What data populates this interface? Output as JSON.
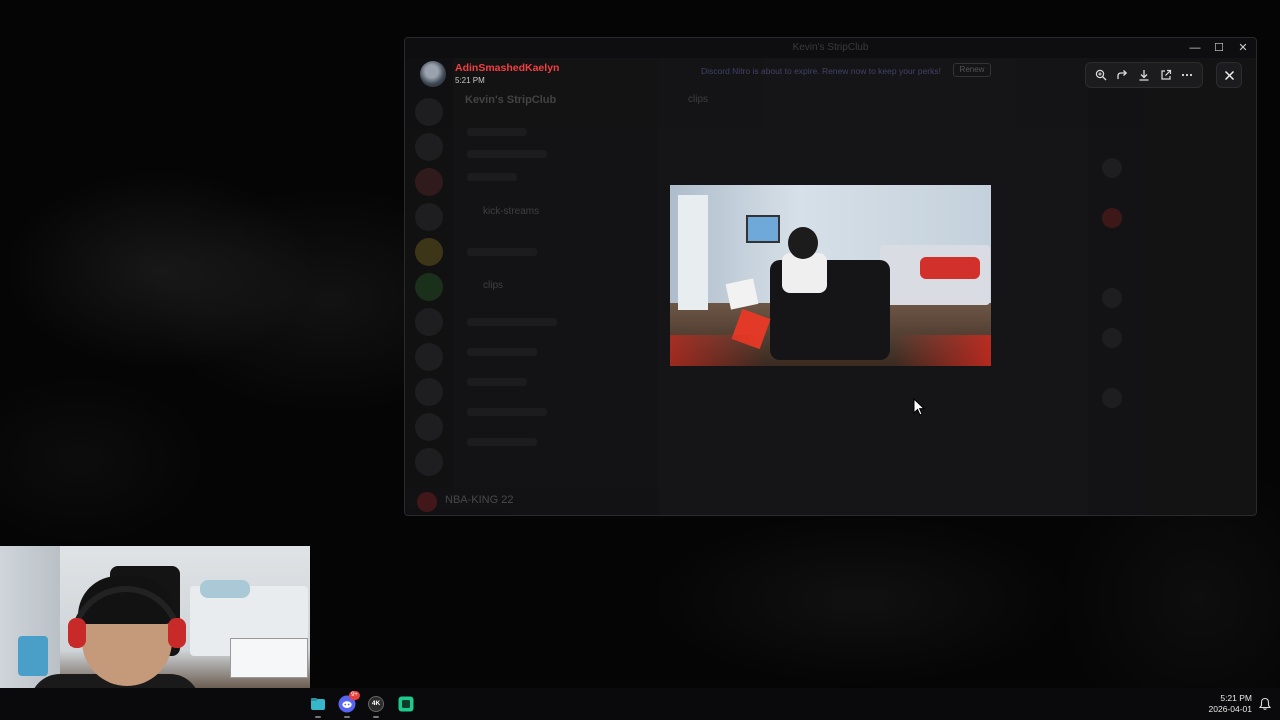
{
  "window": {
    "title": "Kevin's StripClub",
    "minimize_glyph": "—",
    "maximize_glyph": "☐",
    "close_glyph": "✕"
  },
  "discord_bg": {
    "server_name": "Kevin's StripClub",
    "channel_name": "clips",
    "channels": [
      "kick-streams",
      "clips"
    ],
    "current_user": "NBA-KING 22"
  },
  "viewer": {
    "author_name": "AdinSmashedKaelyn",
    "timestamp": "5:21 PM",
    "notice_text": "Discord Nitro is about to expire. Renew now to keep your perks!",
    "notice_button": "Renew",
    "tools": [
      "zoom-in-icon",
      "forward-icon",
      "download-icon",
      "open-external-icon",
      "more-icon"
    ],
    "close_label": "Close"
  },
  "taskbar": {
    "apps": [
      {
        "name": "files",
        "color": "#35b6c9"
      },
      {
        "name": "discord",
        "color": "#5865f2",
        "badge": "9+"
      },
      {
        "name": "4k-video-downloader",
        "label": "4K",
        "color": "#2b2b2b"
      },
      {
        "name": "media-app",
        "color": "#1ec98b"
      }
    ],
    "time": "5:21 PM",
    "date": "2026-04-01"
  }
}
